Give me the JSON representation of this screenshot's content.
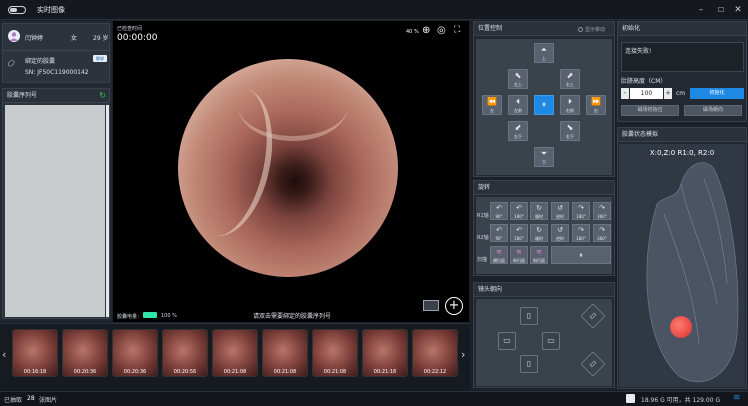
{
  "app": {
    "title": "实时图像"
  },
  "patient": {
    "name": "闫钟婷",
    "gender": "女",
    "age": "29 岁",
    "bind_label": "绑定的胶囊",
    "bind_button": "解绑",
    "sn": "SN: JF50C119000142"
  },
  "capsule_list": {
    "title": "胶囊序列号"
  },
  "video": {
    "label": "已检查时间",
    "timer": "00:00:00",
    "zoom": "40 %",
    "battery_label": "胶囊电量：",
    "battery_pct": "100 %",
    "battery_level": 1.0,
    "prompt": "请双击需要绑定的胶囊序列号"
  },
  "thumbnails": [
    "00:16:18",
    "00:20:36",
    "00:20:36",
    "00:20:56",
    "00:21:08",
    "00:21:08",
    "00:21:08",
    "00:21:18",
    "00:22:12"
  ],
  "position_control": {
    "title": "位置控制",
    "display_move": "显示移动",
    "buttons": {
      "up": "上",
      "left_up": "左上",
      "right_up": "右上",
      "left": "左",
      "right": "右",
      "left_front": "左前",
      "front": "前",
      "right_front": "右前",
      "rear": "后",
      "left_rear": "左后",
      "back": "后",
      "right_down": "右后",
      "left_down": "左下",
      "right_down2": "右下",
      "down": "下",
      "enter": "进",
      "exit": "出"
    }
  },
  "rotation": {
    "title": "旋转",
    "r1_label": "R1轴",
    "r2_label": "R2轴",
    "scan_label": "扫描",
    "r1": [
      "90°",
      "180°",
      "顺时",
      "逆时",
      "180°",
      "360°"
    ],
    "r2": [
      "90°",
      "180°",
      "顺时",
      "逆时",
      "180°",
      "360°"
    ],
    "scan": [
      "横扫面",
      "纵扫面",
      "斜扫面"
    ]
  },
  "lens": {
    "title": "镜头朝向"
  },
  "init": {
    "title": "初始化",
    "status_text": "连接失败!",
    "height_label": "肚脐高度（CM）",
    "height_value": "100",
    "unit": "cm",
    "init_button": "初始化",
    "reset_position": "磁场初始位",
    "reset_direction": "磁场朝向"
  },
  "capsule_state": {
    "title": "胶囊状态模拟",
    "coords": "X:0,Z:0  R1:0,  R2:0"
  },
  "status": {
    "captured_label": "已抽取",
    "captured_count": "28",
    "images_label": "张图片",
    "storage": "18.96 G 可用，共 129.00 G"
  },
  "colors": {
    "accent": "#1e88e5",
    "battery": "#2ee6a8"
  }
}
